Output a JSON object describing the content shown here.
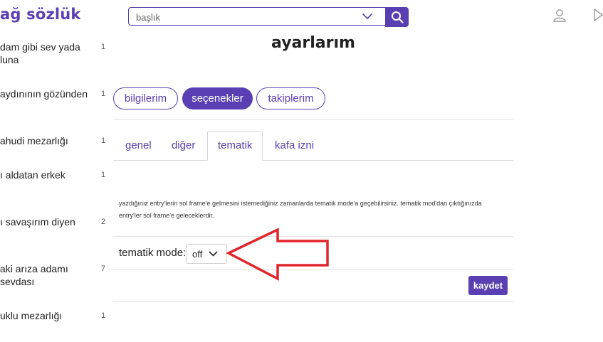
{
  "header": {
    "logo": "ağ sözlük",
    "search": {
      "value": "",
      "placeholder": "başlık"
    }
  },
  "sidebar": {
    "items": [
      {
        "line1": "dam gibi sev yada",
        "line2": "luna",
        "count": "1"
      },
      {
        "line1": "aydınının gözünden",
        "line2": "",
        "count": "1"
      },
      {
        "line1": "ahudi mezarlığı",
        "line2": "",
        "count": "1"
      },
      {
        "line1": "ı aldatan erkek",
        "line2": "",
        "count": "1"
      },
      {
        "line1": "ı savaşırım diyen",
        "line2": "",
        "count": "2"
      },
      {
        "line1": "aki arıza adamı",
        "line2": "sevdası",
        "count": "7"
      },
      {
        "line1": "uklu mezarlığı",
        "line2": "",
        "count": "1"
      }
    ]
  },
  "main": {
    "title": "ayarlarım",
    "pills": [
      {
        "label": "bilgilerim",
        "active": false
      },
      {
        "label": "seçenekler",
        "active": true
      },
      {
        "label": "takiplerim",
        "active": false
      }
    ],
    "tabs": [
      {
        "label": "genel",
        "active": false
      },
      {
        "label": "diğer",
        "active": false
      },
      {
        "label": "tematik",
        "active": true
      },
      {
        "label": "kafa izni",
        "active": false
      }
    ],
    "info_line1": "yazdığınız entry'lerin sol frame'e gelmesini istemediğiniz zamanlarda tematik mode'a geçebilirsiniz. tematik mod'dan çıktığınızda",
    "info_line2": "entry'ler sol frame'e geleceklerdir.",
    "mode_label": "tematik mode:",
    "mode_value": "off",
    "save_label": "kaydet"
  },
  "colors": {
    "accent": "#5a3fb3",
    "annotation": "#e0252b"
  },
  "icons": {
    "search": "search-icon",
    "dropdown": "chevron-down-icon",
    "user": "user-icon",
    "message": "message-icon",
    "annotation": "arrow-left-icon"
  }
}
